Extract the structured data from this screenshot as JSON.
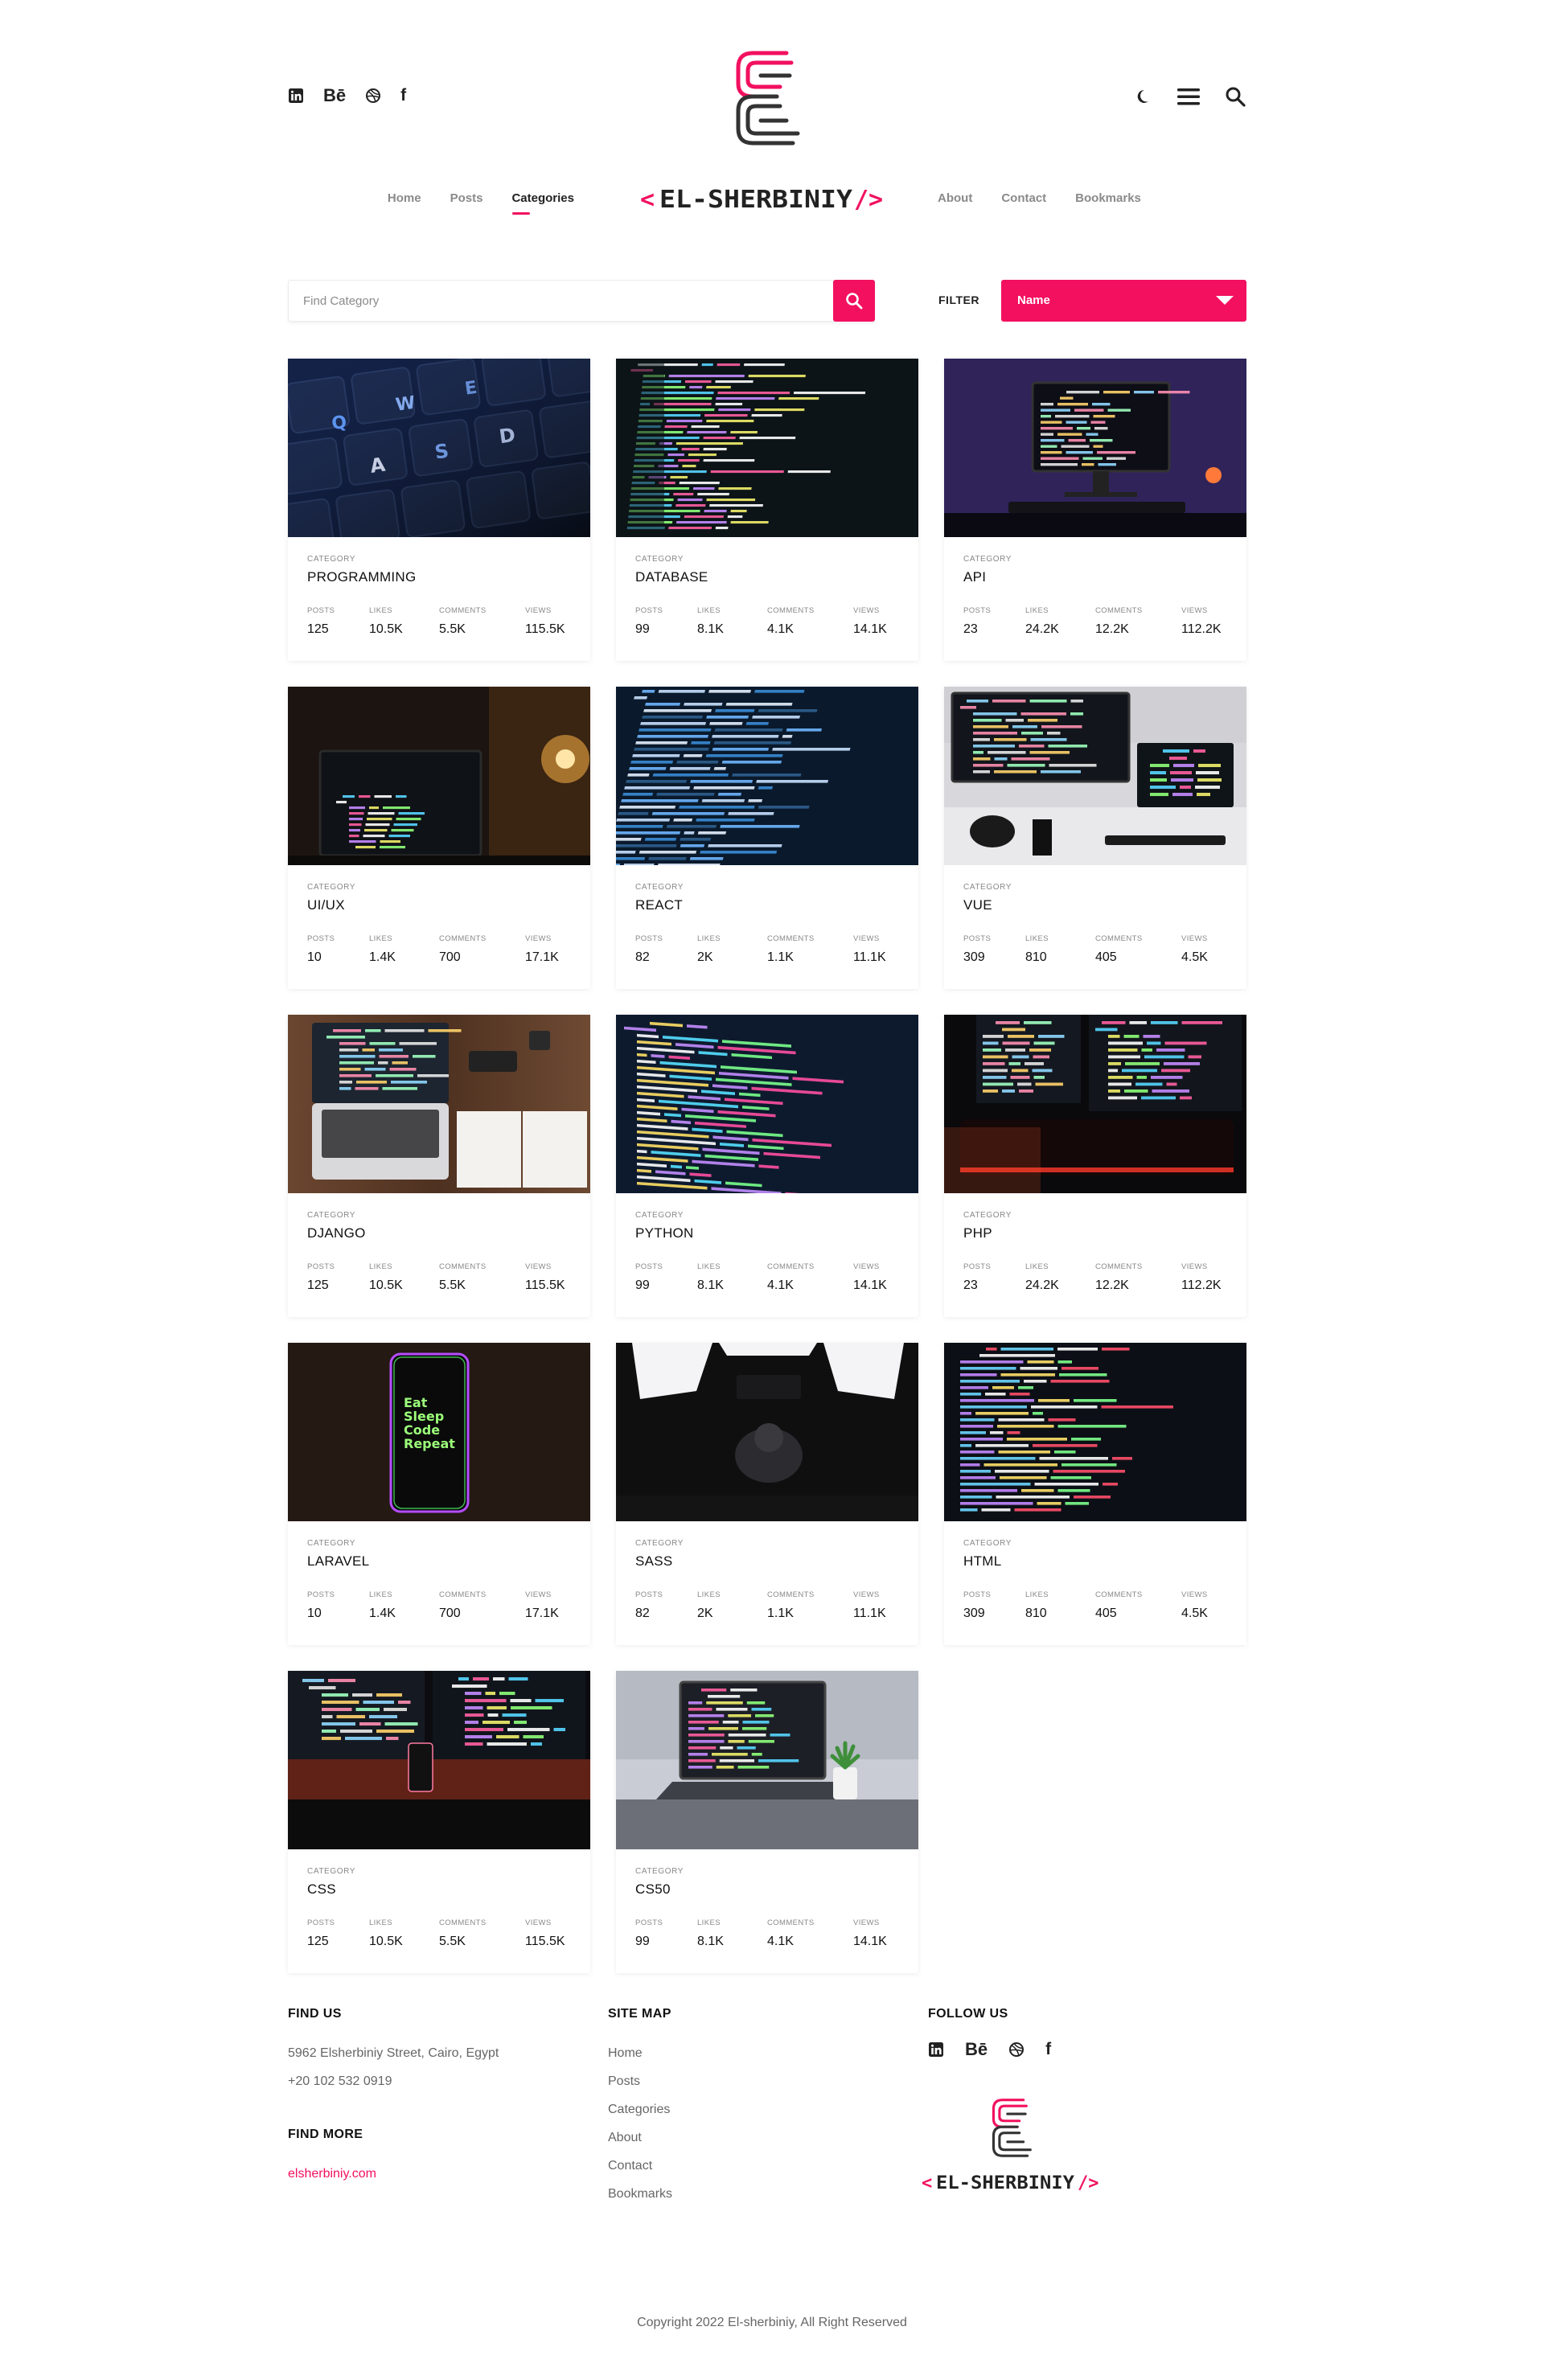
{
  "header": {
    "social_icons": [
      "linkedin-icon",
      "behance-icon",
      "dribbble-icon",
      "facebook-icon"
    ],
    "behance_text": "Bē",
    "facebook_text": "f",
    "tool_icons": [
      "moon-icon",
      "menu-icon",
      "search-icon"
    ]
  },
  "nav": {
    "left": [
      "Home",
      "Posts",
      "Categories"
    ],
    "active": "Categories",
    "right": [
      "About",
      "Contact",
      "Bookmarks"
    ],
    "wordmark": "EL-SHERBINIY",
    "wordmark_prefix": "<",
    "wordmark_suffix": "/>"
  },
  "search": {
    "placeholder": "Find Category",
    "filter_label": "FILTER",
    "filter_value": "Name"
  },
  "card_labels": {
    "category": "CATEGORY",
    "posts": "POSTS",
    "likes": "LIKES",
    "comments": "COMMENTS",
    "views": "VIEWS"
  },
  "categories": [
    {
      "name": "PROGRAMMING",
      "posts": "125",
      "likes": "10.5K",
      "comments": "5.5K",
      "views": "115.5K"
    },
    {
      "name": "DATABASE",
      "posts": "99",
      "likes": "8.1K",
      "comments": "4.1K",
      "views": "14.1K"
    },
    {
      "name": "API",
      "posts": "23",
      "likes": "24.2K",
      "comments": "12.2K",
      "views": "112.2K"
    },
    {
      "name": "UI/UX",
      "posts": "10",
      "likes": "1.4K",
      "comments": "700",
      "views": "17.1K"
    },
    {
      "name": "REACT",
      "posts": "82",
      "likes": "2K",
      "comments": "1.1K",
      "views": "11.1K"
    },
    {
      "name": "VUE",
      "posts": "309",
      "likes": "810",
      "comments": "405",
      "views": "4.5K"
    },
    {
      "name": "DJANGO",
      "posts": "125",
      "likes": "10.5K",
      "comments": "5.5K",
      "views": "115.5K"
    },
    {
      "name": "PYTHON",
      "posts": "99",
      "likes": "8.1K",
      "comments": "4.1K",
      "views": "14.1K"
    },
    {
      "name": "PHP",
      "posts": "23",
      "likes": "24.2K",
      "comments": "12.2K",
      "views": "112.2K"
    },
    {
      "name": "LARAVEL",
      "posts": "10",
      "likes": "1.4K",
      "comments": "700",
      "views": "17.1K"
    },
    {
      "name": "SASS",
      "posts": "82",
      "likes": "2K",
      "comments": "1.1K",
      "views": "11.1K"
    },
    {
      "name": "HTML",
      "posts": "309",
      "likes": "810",
      "comments": "405",
      "views": "4.5K"
    },
    {
      "name": "CSS",
      "posts": "125",
      "likes": "10.5K",
      "comments": "5.5K",
      "views": "115.5K"
    },
    {
      "name": "CS50",
      "posts": "99",
      "likes": "8.1K",
      "comments": "4.1K",
      "views": "14.1K"
    }
  ],
  "phone_words": [
    "Eat",
    "Sleep",
    "Code",
    "Repeat"
  ],
  "footer": {
    "find_us": {
      "title": "FIND US",
      "address": "5962 Elsherbiniy Street, Cairo, Egypt",
      "phone": "+20 102 532 0919"
    },
    "find_more": {
      "title": "FIND MORE",
      "link": "elsherbiniy.com"
    },
    "site_map": {
      "title": "SITE MAP",
      "links": [
        "Home",
        "Posts",
        "Categories",
        "About",
        "Contact",
        "Bookmarks"
      ]
    },
    "follow_us": {
      "title": "FOLLOW US"
    },
    "copyright": "Copyright 2022 El-sherbiniy, All Right Reserved"
  },
  "colors": {
    "accent": "#f2105f",
    "text_dark": "#111111",
    "text_muted": "#888888"
  }
}
